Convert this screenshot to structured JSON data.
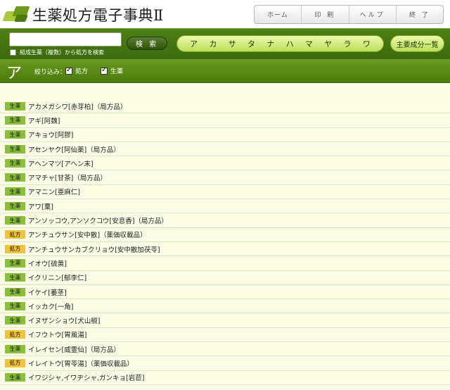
{
  "header": {
    "title": "生薬処方電子事典Ⅱ",
    "nav": [
      "ホーム",
      "印 刷",
      "ヘルプ",
      "終 了"
    ]
  },
  "toolbar": {
    "search_value": "",
    "search_button": "検 索",
    "combo_label": "組成生薬（複数）から処方を検索",
    "combo_checked": false,
    "kana": [
      "ア",
      "カ",
      "サ",
      "タ",
      "ナ",
      "ハ",
      "マ",
      "ヤ",
      "ラ",
      "ワ"
    ],
    "main_ingredients": "主要成分一覧"
  },
  "filter": {
    "current_kana": "ア",
    "label": "絞り込み：",
    "prescription_label": "処方",
    "prescription_checked": true,
    "herb_label": "生薬",
    "herb_checked": true
  },
  "items": [
    {
      "type": "生薬",
      "kind": "herb",
      "name": "アカメガシワ[赤芽柏]（局方品）"
    },
    {
      "type": "生薬",
      "kind": "herb",
      "name": "アギ[阿魏]"
    },
    {
      "type": "生薬",
      "kind": "herb",
      "name": "アキョウ[阿膠]"
    },
    {
      "type": "生薬",
      "kind": "herb",
      "name": "アセンヤク[阿仙薬]（局方品）"
    },
    {
      "type": "生薬",
      "kind": "herb",
      "name": "アヘンマツ[アヘン末]"
    },
    {
      "type": "生薬",
      "kind": "herb",
      "name": "アマチャ[甘茶]（局方品）"
    },
    {
      "type": "生薬",
      "kind": "herb",
      "name": "アマニン[亜麻仁]"
    },
    {
      "type": "生薬",
      "kind": "herb",
      "name": "アワ[粟]"
    },
    {
      "type": "生薬",
      "kind": "herb",
      "name": "アンソッコウ,アンソクコウ[安息香]（局方品）"
    },
    {
      "type": "処方",
      "kind": "rx",
      "name": "アンチュウサン[安中散]（薬価収載品）"
    },
    {
      "type": "処方",
      "kind": "rx",
      "name": "アンチュウサンカブクリョウ[安中散加茯苓]"
    },
    {
      "type": "生薬",
      "kind": "herb",
      "name": "イオウ[硫黄]"
    },
    {
      "type": "生薬",
      "kind": "herb",
      "name": "イクリニン[郁李仁]"
    },
    {
      "type": "生薬",
      "kind": "herb",
      "name": "イケイ[萎茎]"
    },
    {
      "type": "生薬",
      "kind": "herb",
      "name": "イッカク[一角]"
    },
    {
      "type": "生薬",
      "kind": "herb",
      "name": "イヌザンショウ[犬山椒]"
    },
    {
      "type": "処方",
      "kind": "rx",
      "name": "イフウトウ[胃風湯]"
    },
    {
      "type": "生薬",
      "kind": "herb",
      "name": "イレイセン[威霊仙]（局方品）"
    },
    {
      "type": "処方",
      "kind": "rx",
      "name": "イレイトウ[胃苓湯]（薬価収載品）"
    },
    {
      "type": "生薬",
      "kind": "herb",
      "name": "イワジシャ,イワヂシャ,ガンキョ[岩苣]"
    }
  ]
}
